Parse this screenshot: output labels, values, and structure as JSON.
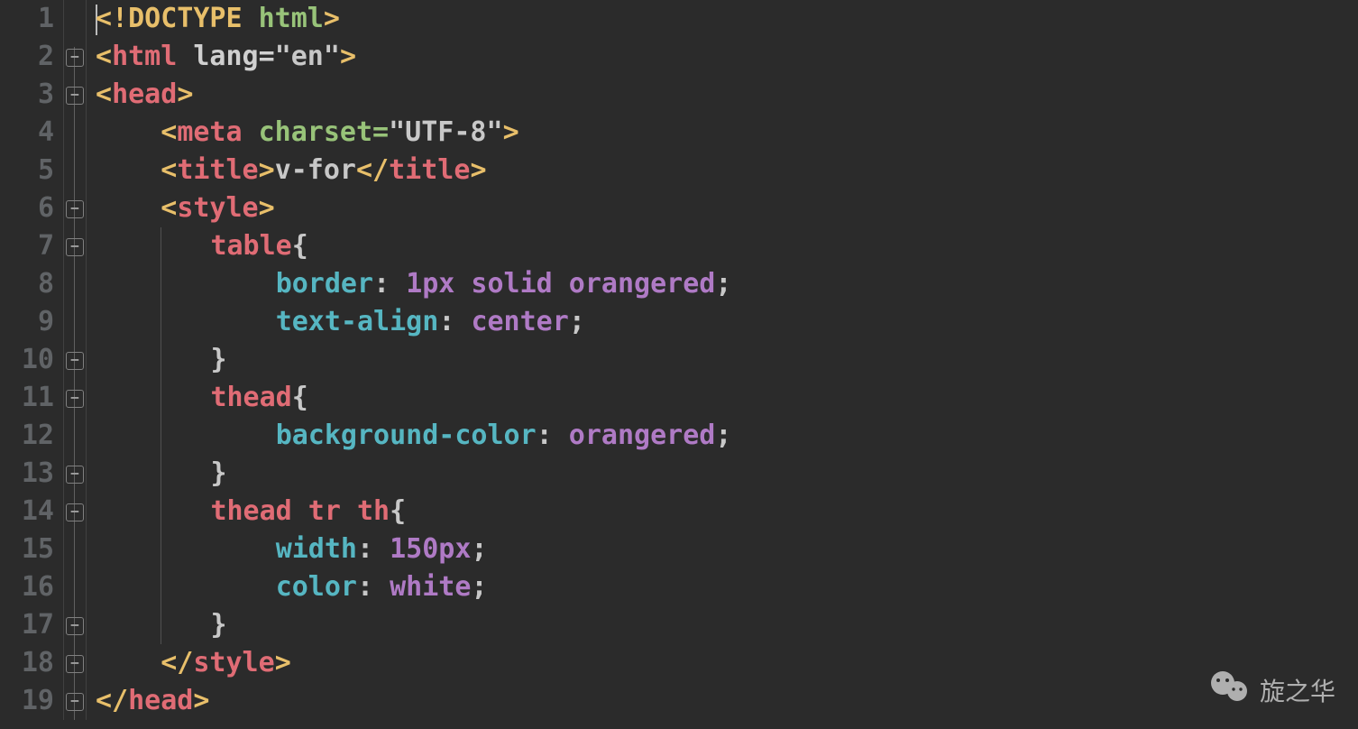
{
  "line_numbers": [
    "1",
    "2",
    "3",
    "4",
    "5",
    "6",
    "7",
    "8",
    "9",
    "10",
    "11",
    "12",
    "13",
    "14",
    "15",
    "16",
    "17",
    "18",
    "19"
  ],
  "fold_markers": [
    {
      "line": 2,
      "glyph": "−"
    },
    {
      "line": 3,
      "glyph": "−"
    },
    {
      "line": 6,
      "glyph": "−"
    },
    {
      "line": 7,
      "glyph": "−"
    },
    {
      "line": 10,
      "glyph": "−"
    },
    {
      "line": 11,
      "glyph": "−"
    },
    {
      "line": 13,
      "glyph": "−"
    },
    {
      "line": 14,
      "glyph": "−"
    },
    {
      "line": 17,
      "glyph": "−"
    },
    {
      "line": 18,
      "glyph": "−"
    },
    {
      "line": 19,
      "glyph": "−"
    }
  ],
  "code": {
    "l1": {
      "open": "<!",
      "doctype": "DOCTYPE ",
      "name": "html",
      "close": ">"
    },
    "l2": {
      "open": "<",
      "tag": "html ",
      "attr": "lang=",
      "str": "\"en\"",
      "close": ">"
    },
    "l3": {
      "open": "<",
      "tag": "head",
      "close": ">"
    },
    "l4": {
      "open": "<",
      "tag": "meta ",
      "attr": "charset=",
      "str": "\"UTF-8\"",
      "close": ">"
    },
    "l5": {
      "open1": "<",
      "tag1": "title",
      "close1": ">",
      "text": "v-for",
      "open2": "</",
      "tag2": "title",
      "close2": ">"
    },
    "l6": {
      "open": "<",
      "tag": "style",
      "close": ">"
    },
    "l7": {
      "sel": "table",
      "brace": "{"
    },
    "l8": {
      "prop": "border",
      "colon": ": ",
      "val": "1px solid orangered",
      "semi": ";"
    },
    "l9": {
      "prop": "text-align",
      "colon": ": ",
      "val": "center",
      "semi": ";"
    },
    "l10": {
      "brace": "}"
    },
    "l11": {
      "sel": "thead",
      "brace": "{"
    },
    "l12": {
      "prop": "background-color",
      "colon": ": ",
      "val": "orangered",
      "semi": ";"
    },
    "l13": {
      "brace": "}"
    },
    "l14": {
      "sel": "thead tr th",
      "brace": "{"
    },
    "l15": {
      "prop": "width",
      "colon": ": ",
      "val": "150px",
      "semi": ";"
    },
    "l16": {
      "prop": "color",
      "colon": ": ",
      "val": "white",
      "semi": ";"
    },
    "l17": {
      "brace": "}"
    },
    "l18": {
      "open": "</",
      "tag": "style",
      "close": ">"
    },
    "l19": {
      "open": "</",
      "tag": "head",
      "close": ">"
    }
  },
  "watermark_text": "旋之华"
}
